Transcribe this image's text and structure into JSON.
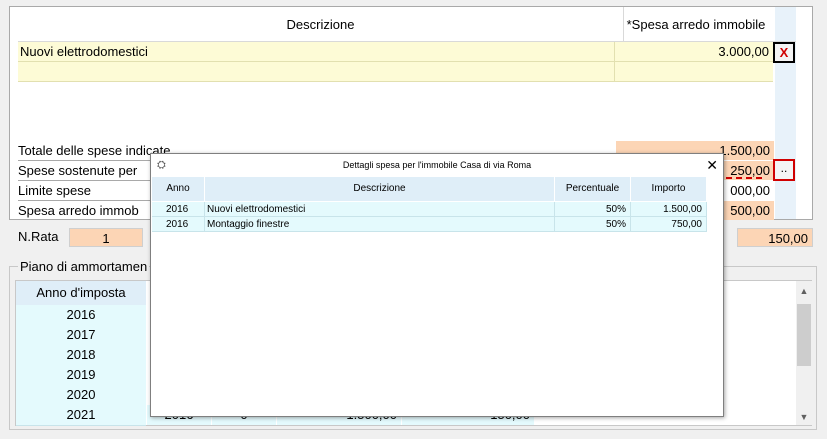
{
  "table": {
    "col_desc": "Descrizione",
    "col_spesa": "*Spesa arredo immobile",
    "rows": [
      {
        "desc": "Nuovi elettrodomestici",
        "value": "3.000,00"
      },
      {
        "desc": "",
        "value": ""
      }
    ],
    "delete_label": "X"
  },
  "summary": {
    "totale_label": "Totale delle spese indicate",
    "totale_value": "1.500,00",
    "sostenute_label": "Spese sostenute per",
    "sostenute_value": "250,00",
    "limite_label": "Limite spese",
    "limite_value": "000,00",
    "arredo_label": "Spesa arredo immob",
    "arredo_value": "500,00",
    "details_button_label": ".."
  },
  "nrata": {
    "label": "N.Rata",
    "value": "1",
    "rata_value": "150,00"
  },
  "piano": {
    "title": "Piano di ammortamen",
    "col_anno": "Anno d'imposta",
    "years": [
      "2016",
      "2017",
      "2018",
      "2019",
      "2020",
      "2021"
    ],
    "last_row_partial": [
      "2016",
      "0",
      "1.500,00",
      "150,00"
    ]
  },
  "dialog": {
    "title": "Dettagli spesa per l'immobile  Casa di via Roma",
    "close_label": "✕",
    "columns": {
      "anno": "Anno",
      "descrizione": "Descrizione",
      "percentuale": "Percentuale",
      "importo": "Importo"
    },
    "rows": [
      {
        "anno": "2016",
        "descrizione": "Nuovi elettrodomestici",
        "percentuale": "50%",
        "importo": "1.500,00"
      },
      {
        "anno": "2016",
        "descrizione": "Montaggio finestre",
        "percentuale": "50%",
        "importo": "750,00"
      }
    ]
  },
  "colors": {
    "accent_red": "#d00000",
    "row_yellow": "#fdfbd6",
    "value_orange": "#fcd5b5",
    "row_cyan": "#e4fafd"
  }
}
